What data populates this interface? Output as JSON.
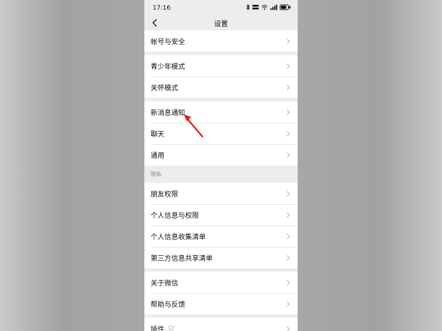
{
  "status_bar": {
    "time": "17:16",
    "icons": [
      "bluetooth-icon",
      "network-speed-icon",
      "wifi-icon",
      "signal-icon",
      "battery-icon"
    ],
    "battery_level": "80"
  },
  "nav": {
    "title": "设置",
    "back_icon": "chevron-left-icon"
  },
  "groups": [
    {
      "items": [
        "帐号与安全"
      ]
    },
    {
      "items": [
        "青少年模式",
        "关怀模式"
      ]
    },
    {
      "items": [
        "新消息通知",
        "聊天",
        "通用"
      ]
    }
  ],
  "privacy": {
    "header": "隐私",
    "items": [
      "朋友权限",
      "个人信息与权限",
      "个人信息收集清单",
      "第三方信息共享清单"
    ]
  },
  "about_group": {
    "items": [
      "关于微信",
      "帮助与反馈"
    ]
  },
  "plugins": {
    "label": "插件",
    "badge_icon": "shield-icon"
  },
  "colors": {
    "annotation_arrow": "#e02020",
    "background": "#ededed",
    "row": "#ffffff"
  }
}
